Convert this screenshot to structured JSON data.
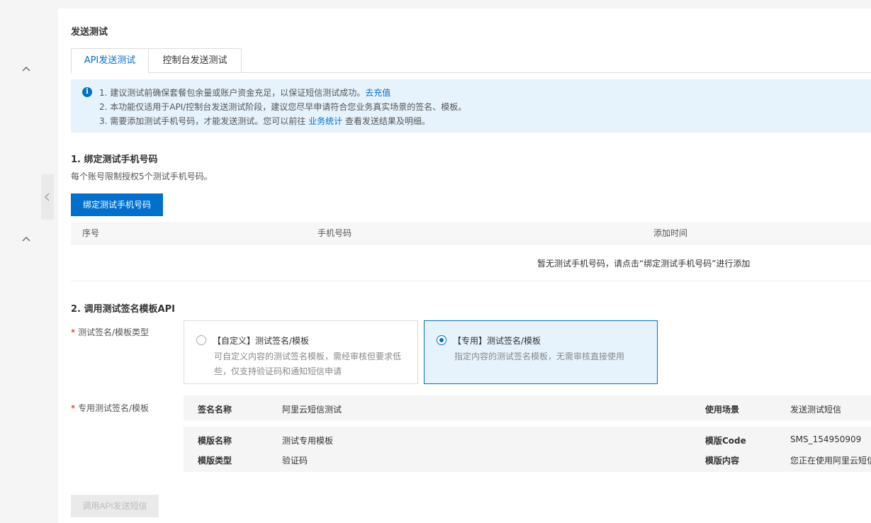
{
  "section_title": "发送测试",
  "tabs": [
    {
      "label": "API发送测试",
      "active": true
    },
    {
      "label": "控制台发送测试",
      "active": false
    }
  ],
  "notice": {
    "icon": "info-icon",
    "line1_text": "1. 建议测试前确保套餐包余量或账户资金充足，以保证短信测试成功。",
    "line1_link": "去充值",
    "line2_text": "2. 本功能仅适用于API/控制台发送测试阶段，建议您尽早申请符合您业务真实场景的签名、模板。",
    "line3_text": "3. 需要添加测试手机号码，才能发送测试。您可以前往 ",
    "line3_link": "业务统计",
    "line3_suffix": " 查看发送结果及明细。"
  },
  "step1": {
    "title": "1. 绑定测试手机号码",
    "desc": "每个账号限制授权5个测试手机号码。",
    "button": "绑定测试手机号码",
    "columns": [
      "序号",
      "手机号码",
      "添加时间"
    ],
    "empty_text": "暂无测试手机号码，请点击“绑定测试手机号码”进行添加"
  },
  "step2": {
    "title": "2. 调用测试签名模板API",
    "type_label": "测试签名/模板类型",
    "options": [
      {
        "title": "【自定义】测试签名/模板",
        "desc": "可自定义内容的测试签名模板，需经审核但要求低些，仅支持验证码和通知短信申请",
        "selected": false
      },
      {
        "title": "【专用】测试签名/模板",
        "desc": "指定内容的测试签名模板，无需审核直接使用",
        "selected": true
      }
    ],
    "dedicated_label": "专用测试签名/模板",
    "info": {
      "sign_name_key": "签名名称",
      "sign_name_val": "阿里云短信测试",
      "scene_key": "使用场景",
      "scene_val": "发送测试短信",
      "tpl_name_key": "模版名称",
      "tpl_name_val": "测试专用模板",
      "tpl_code_key": "模版Code",
      "tpl_code_val": "SMS_154950909",
      "tpl_type_key": "模版类型",
      "tpl_type_val": "验证码",
      "tpl_content_key": "模版内容",
      "tpl_content_val": "您正在使用阿里云短信"
    },
    "call_button": "调用API发送短信"
  },
  "colors": {
    "primary": "#0070cc",
    "notice_bg": "#e6f3fd",
    "required": "#ee0000"
  }
}
